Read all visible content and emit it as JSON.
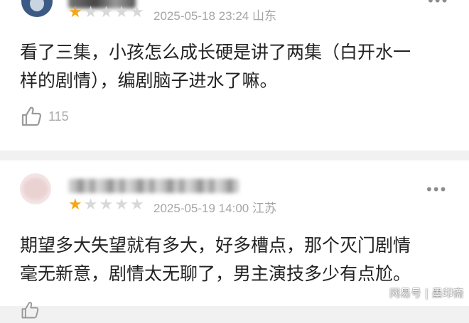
{
  "comments": [
    {
      "rating": 1,
      "max_rating": 5,
      "date": "2025-05-18 23:24",
      "location": "山东",
      "text_line1": "看了三集，小孩怎么成长硬是讲了两集（白开水一",
      "text_line2": "样的剧情），编剧脑子进水了嘛。",
      "likes": "115",
      "more_glyph": "•••"
    },
    {
      "rating": 1,
      "max_rating": 5,
      "date": "2025-05-19 14:00",
      "location": "江苏",
      "text_line1": "期望多大失望就有多大，好多槽点，那个灭门剧情",
      "text_line2": "毫无新意，剧情太无聊了，男主演技多少有点尬。",
      "more_glyph": "•••"
    }
  ],
  "icons": {
    "star": "★",
    "like": "thumbs-up-icon",
    "more": "more-horizontal-icon"
  },
  "colors": {
    "star_on": "#f2a818",
    "star_off": "#d8d8d8",
    "meta_text": "#a6a6a6",
    "body_text": "#222222"
  },
  "watermark": "网易号 | 墨印斋"
}
